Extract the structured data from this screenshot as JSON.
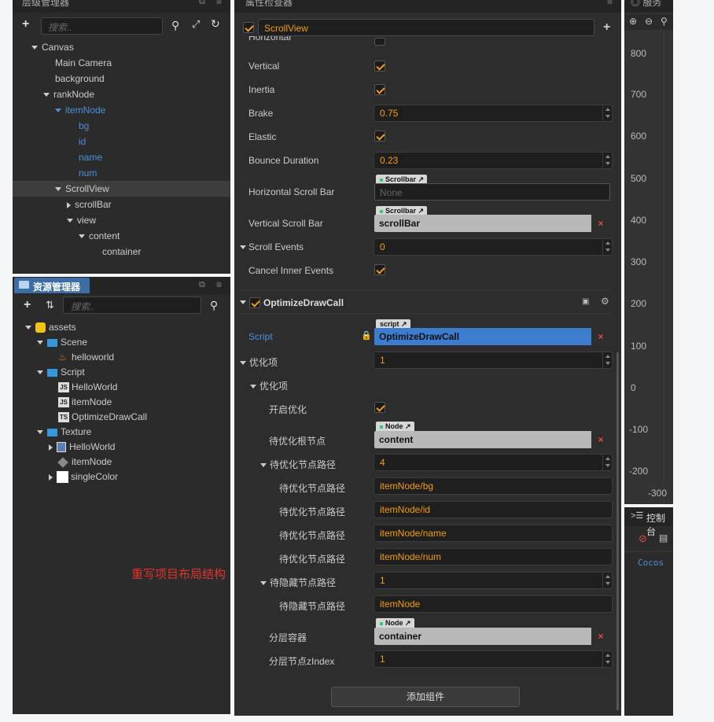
{
  "hierarchy": {
    "title": "层级管理器",
    "search_placeholder": "搜索..",
    "nodes": [
      {
        "label": "Canvas"
      },
      {
        "label": "Main Camera"
      },
      {
        "label": "background"
      },
      {
        "label": "rankNode"
      },
      {
        "label": "itemNode"
      },
      {
        "label": "bg"
      },
      {
        "label": "id"
      },
      {
        "label": "name"
      },
      {
        "label": "num"
      },
      {
        "label": "ScrollView"
      },
      {
        "label": "scrollBar"
      },
      {
        "label": "view"
      },
      {
        "label": "content"
      },
      {
        "label": "container"
      }
    ]
  },
  "assets": {
    "title": "资源管理器",
    "search_placeholder": "搜索..",
    "items": [
      {
        "label": "assets"
      },
      {
        "label": "Scene"
      },
      {
        "label": "helloworld"
      },
      {
        "label": "Script"
      },
      {
        "label": "HelloWorld",
        "badge": "JS"
      },
      {
        "label": "itemNode",
        "badge": "JS"
      },
      {
        "label": "OptimizeDrawCall",
        "badge": "TS"
      },
      {
        "label": "Texture"
      },
      {
        "label": "HelloWorld"
      },
      {
        "label": "itemNode"
      },
      {
        "label": "singleColor"
      }
    ],
    "annotation": "重写项目布局结构"
  },
  "inspector": {
    "title": "属性检查器",
    "node_name": "ScrollView",
    "props": {
      "horizontal": "Horizontal",
      "vertical": "Vertical",
      "inertia": "Inertia",
      "brake": "Brake",
      "brake_value": "0.75",
      "elastic": "Elastic",
      "bounce": "Bounce Duration",
      "bounce_value": "0.23",
      "hscroll": "Horizontal Scroll Bar",
      "hscroll_tag": "Scrollbar",
      "hscroll_value": "None",
      "vscroll": "Vertical Scroll Bar",
      "vscroll_tag": "Scrollbar",
      "vscroll_value": "scrollBar",
      "events": "Scroll Events",
      "events_value": "0",
      "cancel": "Cancel Inner Events"
    },
    "component": {
      "title": "OptimizeDrawCall",
      "script_label": "Script",
      "script_tag": "script",
      "script_value": "OptimizeDrawCall",
      "opt_items": "优化项",
      "opt_items_value": "1",
      "opt_item": "优化项",
      "enable": "开启优化",
      "root": "待优化根节点",
      "root_tag": "Node",
      "root_value": "content",
      "paths": "待优化节点路径",
      "paths_value": "4",
      "path_label": "待优化节点路径",
      "path_values": [
        "itemNode/bg",
        "itemNode/id",
        "itemNode/name",
        "itemNode/num"
      ],
      "hidden": "待隐藏节点路径",
      "hidden_value": "1",
      "hidden_label": "待隐藏节点路径",
      "hidden_item": "itemNode",
      "layer": "分层容器",
      "layer_tag": "Node",
      "layer_value": "container",
      "zindex": "分层节点zIndex",
      "zindex_value": "1"
    },
    "add_component": "添加组件"
  },
  "scene": {
    "tab": "服务",
    "ruler": [
      "800",
      "700",
      "600",
      "500",
      "400",
      "300",
      "200",
      "100",
      "0",
      "-100",
      "-200",
      "-300"
    ]
  },
  "console": {
    "title": "控制台",
    "text": "Cocos"
  },
  "colors": {
    "accent": "#f39c12",
    "selected": "#4a90d9",
    "panel": "#2b2b2b"
  }
}
